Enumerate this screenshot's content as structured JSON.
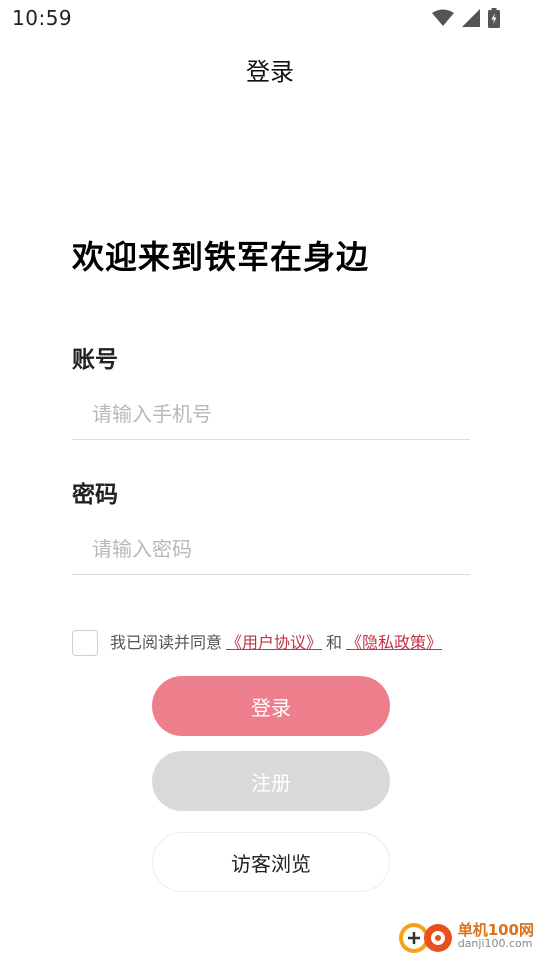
{
  "status_bar": {
    "time": "10:59"
  },
  "nav": {
    "title": "登录"
  },
  "welcome": "欢迎来到铁军在身边",
  "account": {
    "label": "账号",
    "placeholder": "请输入手机号",
    "value": ""
  },
  "password": {
    "label": "密码",
    "placeholder": "请输入密码",
    "value": ""
  },
  "agreement": {
    "prefix": "我已阅读并同意",
    "user_agreement": "《用户协议》",
    "and": "和",
    "privacy_policy": "《隐私政策》",
    "checked": false
  },
  "buttons": {
    "login": "登录",
    "register": "注册",
    "guest": "访客浏览"
  },
  "watermark": {
    "main": "单机100网",
    "sub": "danji100.com"
  },
  "colors": {
    "login_button": "#ec7f8b",
    "register_button": "#d9d9d9",
    "link": "#c0344a"
  }
}
